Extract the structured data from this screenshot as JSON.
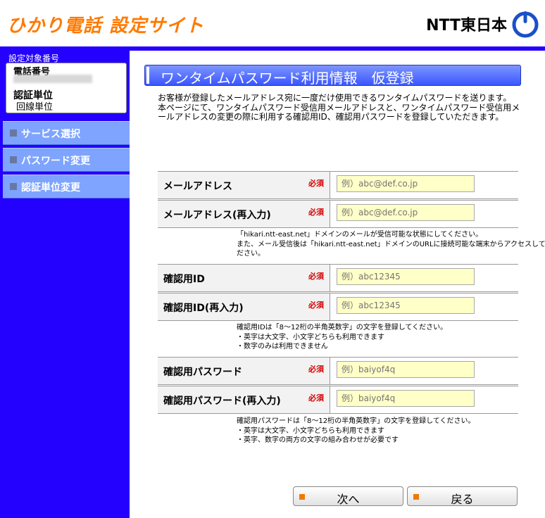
{
  "header": {
    "site_title": "ひかり電話 設定サイト",
    "logo_text": "NTT東日本"
  },
  "sidebar": {
    "target_label": "設定対象番号",
    "phone_label": "電話番号",
    "unit_label": "認証単位",
    "unit_value": "回線単位",
    "menu": [
      {
        "label": "サービス選択"
      },
      {
        "label": "パスワード変更"
      },
      {
        "label": "認証単位変更"
      }
    ]
  },
  "main": {
    "page_title": "ワンタイムパスワード利用情報　仮登録",
    "intro": [
      "お客様が登録したメールアドレス宛に一度だけ使用できるワンタイムパスワードを送ります。",
      "本ページにて、ワンタイムパスワード受信用メールアドレスと、ワンタイムパスワード受信用メールアドレスの変更の際に利用する確認用ID、確認用パスワードを登録していただきます。"
    ],
    "required_label": "必須",
    "fields": [
      {
        "label": "メールアドレス",
        "placeholder": "例）abc@def.co.jp"
      },
      {
        "label": "メールアドレス(再入力)",
        "placeholder": "例）abc@def.co.jp"
      },
      {
        "label": "確認用ID",
        "placeholder": "例）abc12345"
      },
      {
        "label": "確認用ID(再入力)",
        "placeholder": "例）abc12345"
      },
      {
        "label": "確認用パスワード",
        "placeholder": "例）baiyof4q"
      },
      {
        "label": "確認用パスワード(再入力)",
        "placeholder": "例）baiyof4q"
      }
    ],
    "notes": {
      "email": [
        "「hikari.ntt-east.net」ドメインのメールが受信可能な状態にしてください。",
        "また、メール受信後は「hikari.ntt-east.net」ドメインのURLに接続可能な端末からアクセスしてく",
        "ださい。"
      ],
      "id": [
        "確認用IDは「8～12桁の半角英数字」の文字を登録してください。",
        "・英字は大文字、小文字どちらも利用できます",
        "・数字のみは利用できません"
      ],
      "password": [
        "確認用パスワードは「8～12桁の半角英数字」の文字を登録してください。",
        "・英字は大文字、小文字どちらも利用できます",
        "・英字、数字の両方の文字の組み合わせが必要です"
      ]
    },
    "buttons": {
      "next": "次へ",
      "back": "戻る"
    }
  },
  "colors": {
    "sidebar_bg": "#2400ff",
    "title_orange": "#ff7a00",
    "required_red": "#d40000",
    "input_bg": "#ffffc8"
  }
}
